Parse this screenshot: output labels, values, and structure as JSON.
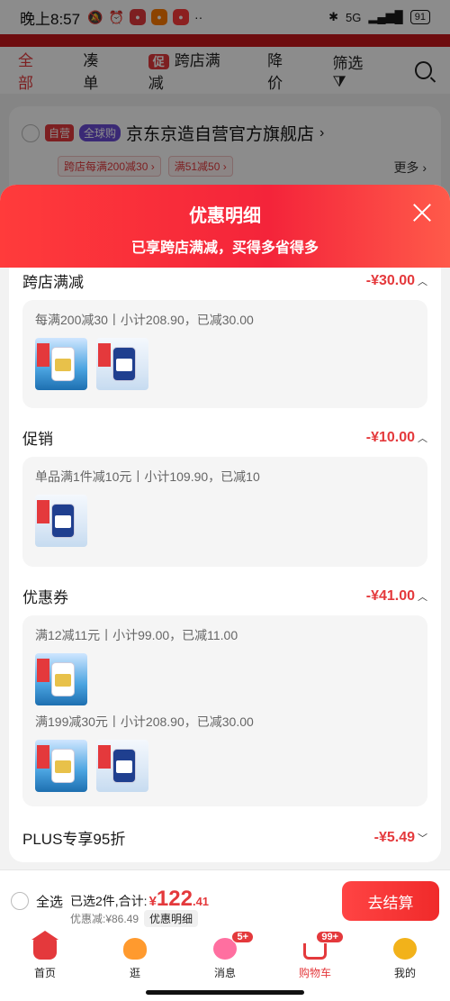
{
  "status_bar": {
    "time": "晚上8:57",
    "network": "5G",
    "battery": "91"
  },
  "filter_bar": {
    "all": "全部",
    "bundle": "凑单",
    "promo_tag": "促",
    "cross_store": "跨店满减",
    "price_drop": "降价",
    "filter": "筛选"
  },
  "store": {
    "tag_self": "自营",
    "tag_global": "全球购",
    "name": "京东京造自营官方旗舰店",
    "chevron": "›",
    "promos": [
      "跨店每满200减30 ›",
      "满51减50 ›"
    ],
    "more": "更多 ›"
  },
  "sheet": {
    "title": "优惠明细",
    "subtitle": "已享跨店满减，买得多省得多",
    "sections": [
      {
        "name": "跨店满减",
        "amount": "-¥30.00",
        "groups": [
          {
            "rule": "每满200减30丨小计208.90，已减30.00"
          }
        ]
      },
      {
        "name": "促销",
        "amount": "-¥10.00",
        "groups": [
          {
            "rule": "单品满1件减10元丨小计109.90，已减10"
          }
        ]
      },
      {
        "name": "优惠券",
        "amount": "-¥41.00",
        "groups": [
          {
            "rule": "满12减11元丨小计99.00，已减11.00"
          },
          {
            "rule": "满199减30元丨小计208.90，已减30.00"
          }
        ]
      },
      {
        "name": "PLUS专享95折",
        "amount": "-¥5.49"
      }
    ]
  },
  "checkout": {
    "select_all": "全选",
    "summary_label": "已选2件,合计:",
    "currency": "¥",
    "total_int": "122",
    "total_dec": ".41",
    "discount_text": "优惠减:¥86.49",
    "detail_btn": "优惠明细",
    "pay_btn": "去结算"
  },
  "tabbar": [
    {
      "label": "首页",
      "icon": "home-icon"
    },
    {
      "label": "逛",
      "icon": "stroll-icon"
    },
    {
      "label": "消息",
      "icon": "message-icon",
      "badge": "5+"
    },
    {
      "label": "购物车",
      "icon": "cart-icon",
      "badge": "99+"
    },
    {
      "label": "我的",
      "icon": "profile-icon"
    }
  ],
  "colors": {
    "accent": "#e4393c"
  }
}
